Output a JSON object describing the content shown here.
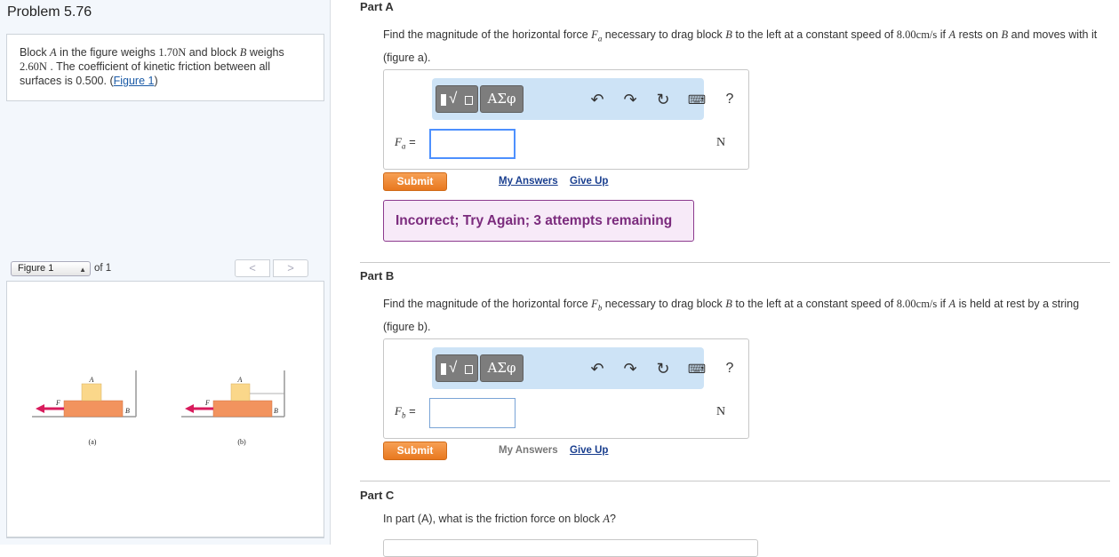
{
  "problem": {
    "title": "Problem 5.76",
    "statement_pre": "Block ",
    "block_a": "A",
    "statement_mid1": " in the figure weighs ",
    "weight_a": "1.70N",
    "statement_mid2": " and block ",
    "block_b": "B",
    "statement_mid3": " weighs ",
    "weight_b": "2.60N",
    "statement_mid4": " . The coefficient of kinetic friction between all surfaces is 0.500. (",
    "figure_link": "Figure 1",
    "statement_end": ")"
  },
  "figure": {
    "selected": "Figure 1",
    "of_text": "of 1",
    "prev_label": "<",
    "next_label": ">",
    "label_a": "A",
    "label_b": "B",
    "label_f": "F",
    "caption_a": "(a)",
    "caption_b": "(b)"
  },
  "toolbar": {
    "greek_label": "ΑΣφ",
    "help_label": "?"
  },
  "parts": [
    {
      "title": "Part A",
      "q1": "Find the magnitude of the horizontal force ",
      "force": "F",
      "sub": "a",
      "q2": " necessary to drag block ",
      "blk": "B",
      "q3": " to the left at a constant speed of ",
      "speed": "8.00cm/s",
      "q4": " if ",
      "blk2": "A",
      "q5": "  rests on ",
      "blk3": "B",
      "q6": "  and moves with it (figure a).",
      "eq_label": "F",
      "eq_sub": "a",
      "eq_sign": "=",
      "input_value": "",
      "units": "N",
      "submit": "Submit",
      "my_answers": "My Answers",
      "give_up": "Give Up",
      "feedback": "Incorrect; Try Again; 3 attempts remaining"
    },
    {
      "title": "Part B",
      "q1": "Find the magnitude of the horizontal force ",
      "force": "F",
      "sub": "b",
      "q2": " necessary to drag block ",
      "blk": "B",
      "q3": " to the left at a constant speed of ",
      "speed": "8.00cm/s",
      "q4": " if ",
      "blk2": "A",
      "q5": "  is held at rest by a string (figure b).",
      "eq_label": "F",
      "eq_sub": "b",
      "eq_sign": "=",
      "input_value": "",
      "units": "N",
      "submit": "Submit",
      "my_answers": "My Answers",
      "give_up": "Give Up"
    },
    {
      "title": "Part C",
      "q1": "In part (A), what is the friction force on block ",
      "blk": "A",
      "q2": "?"
    }
  ]
}
